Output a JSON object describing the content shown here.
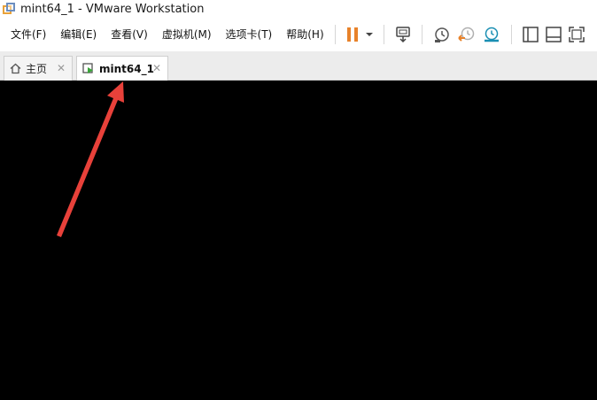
{
  "window": {
    "title": "mint64_1 - VMware Workstation"
  },
  "menu": {
    "items": [
      {
        "label": "文件(F)"
      },
      {
        "label": "编辑(E)"
      },
      {
        "label": "查看(V)"
      },
      {
        "label": "虚拟机(M)"
      },
      {
        "label": "选项卡(T)"
      },
      {
        "label": "帮助(H)"
      }
    ]
  },
  "toolbar": {
    "buttons": [
      {
        "icon": "pause-icon",
        "color": "#e8822a"
      },
      {
        "icon": "chevron-down-icon"
      },
      {
        "icon": "send-ctrl-alt-del-icon"
      },
      {
        "icon": "snapshot-icon"
      },
      {
        "icon": "revert-snapshot-icon",
        "color": "#e8822a"
      },
      {
        "icon": "snapshot-manager-icon",
        "color": "#1a8fb3"
      },
      {
        "icon": "library-view-icon"
      },
      {
        "icon": "console-view-icon"
      },
      {
        "icon": "fullscreen-icon"
      }
    ]
  },
  "tabs": [
    {
      "label": "主页",
      "icon": "home-icon",
      "active": false
    },
    {
      "label": "mint64_1",
      "icon": "vm-running-icon",
      "active": true
    }
  ],
  "annotation": {
    "color": "#e8413a"
  }
}
